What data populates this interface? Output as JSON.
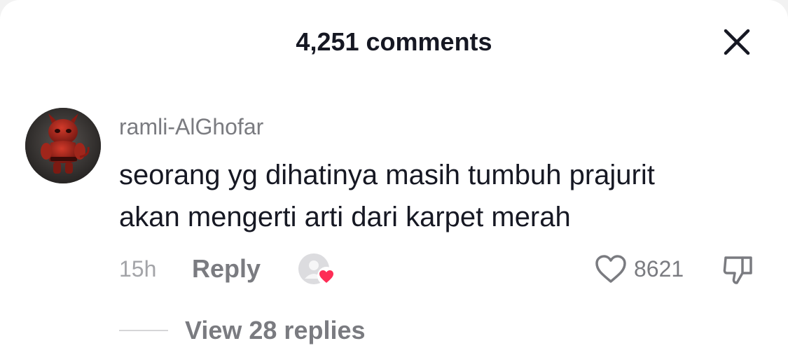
{
  "header": {
    "title": "4,251 comments",
    "close_icon": "close-icon"
  },
  "comment": {
    "author": "ramli-AlGhofar",
    "avatar_icon": "avatar",
    "text_lines": [
      "seorang yg dihatinya masih tumbuh prajurit",
      "akan mengerti arti dari karpet merah"
    ],
    "timestamp": "15h",
    "reply_label": "Reply",
    "creator_liked_icon": "creator-liked-heart-icon",
    "like_icon": "heart-outline-icon",
    "like_count": "8621",
    "dislike_icon": "thumbs-down-icon",
    "view_replies_label": "View 28 replies"
  },
  "colors": {
    "background": "#ffffff",
    "primary_text": "#161823",
    "secondary_text": "#7a7b80",
    "muted_text": "#a3a4a8",
    "heart_accent": "#fe2c55"
  }
}
